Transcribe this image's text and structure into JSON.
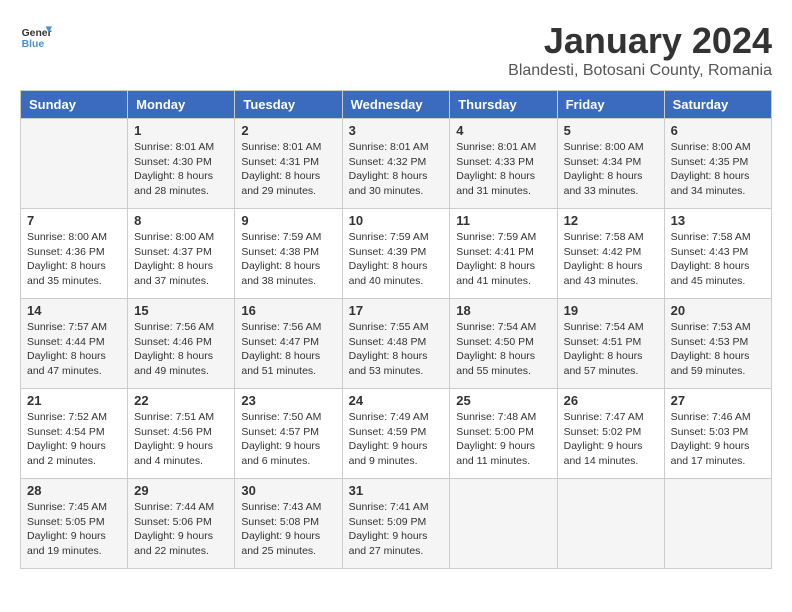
{
  "header": {
    "logo_general": "General",
    "logo_blue": "Blue",
    "month_title": "January 2024",
    "location": "Blandesti, Botosani County, Romania"
  },
  "days_of_week": [
    "Sunday",
    "Monday",
    "Tuesday",
    "Wednesday",
    "Thursday",
    "Friday",
    "Saturday"
  ],
  "weeks": [
    [
      {
        "day": "",
        "info": ""
      },
      {
        "day": "1",
        "info": "Sunrise: 8:01 AM\nSunset: 4:30 PM\nDaylight: 8 hours\nand 28 minutes."
      },
      {
        "day": "2",
        "info": "Sunrise: 8:01 AM\nSunset: 4:31 PM\nDaylight: 8 hours\nand 29 minutes."
      },
      {
        "day": "3",
        "info": "Sunrise: 8:01 AM\nSunset: 4:32 PM\nDaylight: 8 hours\nand 30 minutes."
      },
      {
        "day": "4",
        "info": "Sunrise: 8:01 AM\nSunset: 4:33 PM\nDaylight: 8 hours\nand 31 minutes."
      },
      {
        "day": "5",
        "info": "Sunrise: 8:00 AM\nSunset: 4:34 PM\nDaylight: 8 hours\nand 33 minutes."
      },
      {
        "day": "6",
        "info": "Sunrise: 8:00 AM\nSunset: 4:35 PM\nDaylight: 8 hours\nand 34 minutes."
      }
    ],
    [
      {
        "day": "7",
        "info": "Sunrise: 8:00 AM\nSunset: 4:36 PM\nDaylight: 8 hours\nand 35 minutes."
      },
      {
        "day": "8",
        "info": "Sunrise: 8:00 AM\nSunset: 4:37 PM\nDaylight: 8 hours\nand 37 minutes."
      },
      {
        "day": "9",
        "info": "Sunrise: 7:59 AM\nSunset: 4:38 PM\nDaylight: 8 hours\nand 38 minutes."
      },
      {
        "day": "10",
        "info": "Sunrise: 7:59 AM\nSunset: 4:39 PM\nDaylight: 8 hours\nand 40 minutes."
      },
      {
        "day": "11",
        "info": "Sunrise: 7:59 AM\nSunset: 4:41 PM\nDaylight: 8 hours\nand 41 minutes."
      },
      {
        "day": "12",
        "info": "Sunrise: 7:58 AM\nSunset: 4:42 PM\nDaylight: 8 hours\nand 43 minutes."
      },
      {
        "day": "13",
        "info": "Sunrise: 7:58 AM\nSunset: 4:43 PM\nDaylight: 8 hours\nand 45 minutes."
      }
    ],
    [
      {
        "day": "14",
        "info": "Sunrise: 7:57 AM\nSunset: 4:44 PM\nDaylight: 8 hours\nand 47 minutes."
      },
      {
        "day": "15",
        "info": "Sunrise: 7:56 AM\nSunset: 4:46 PM\nDaylight: 8 hours\nand 49 minutes."
      },
      {
        "day": "16",
        "info": "Sunrise: 7:56 AM\nSunset: 4:47 PM\nDaylight: 8 hours\nand 51 minutes."
      },
      {
        "day": "17",
        "info": "Sunrise: 7:55 AM\nSunset: 4:48 PM\nDaylight: 8 hours\nand 53 minutes."
      },
      {
        "day": "18",
        "info": "Sunrise: 7:54 AM\nSunset: 4:50 PM\nDaylight: 8 hours\nand 55 minutes."
      },
      {
        "day": "19",
        "info": "Sunrise: 7:54 AM\nSunset: 4:51 PM\nDaylight: 8 hours\nand 57 minutes."
      },
      {
        "day": "20",
        "info": "Sunrise: 7:53 AM\nSunset: 4:53 PM\nDaylight: 8 hours\nand 59 minutes."
      }
    ],
    [
      {
        "day": "21",
        "info": "Sunrise: 7:52 AM\nSunset: 4:54 PM\nDaylight: 9 hours\nand 2 minutes."
      },
      {
        "day": "22",
        "info": "Sunrise: 7:51 AM\nSunset: 4:56 PM\nDaylight: 9 hours\nand 4 minutes."
      },
      {
        "day": "23",
        "info": "Sunrise: 7:50 AM\nSunset: 4:57 PM\nDaylight: 9 hours\nand 6 minutes."
      },
      {
        "day": "24",
        "info": "Sunrise: 7:49 AM\nSunset: 4:59 PM\nDaylight: 9 hours\nand 9 minutes."
      },
      {
        "day": "25",
        "info": "Sunrise: 7:48 AM\nSunset: 5:00 PM\nDaylight: 9 hours\nand 11 minutes."
      },
      {
        "day": "26",
        "info": "Sunrise: 7:47 AM\nSunset: 5:02 PM\nDaylight: 9 hours\nand 14 minutes."
      },
      {
        "day": "27",
        "info": "Sunrise: 7:46 AM\nSunset: 5:03 PM\nDaylight: 9 hours\nand 17 minutes."
      }
    ],
    [
      {
        "day": "28",
        "info": "Sunrise: 7:45 AM\nSunset: 5:05 PM\nDaylight: 9 hours\nand 19 minutes."
      },
      {
        "day": "29",
        "info": "Sunrise: 7:44 AM\nSunset: 5:06 PM\nDaylight: 9 hours\nand 22 minutes."
      },
      {
        "day": "30",
        "info": "Sunrise: 7:43 AM\nSunset: 5:08 PM\nDaylight: 9 hours\nand 25 minutes."
      },
      {
        "day": "31",
        "info": "Sunrise: 7:41 AM\nSunset: 5:09 PM\nDaylight: 9 hours\nand 27 minutes."
      },
      {
        "day": "",
        "info": ""
      },
      {
        "day": "",
        "info": ""
      },
      {
        "day": "",
        "info": ""
      }
    ]
  ]
}
